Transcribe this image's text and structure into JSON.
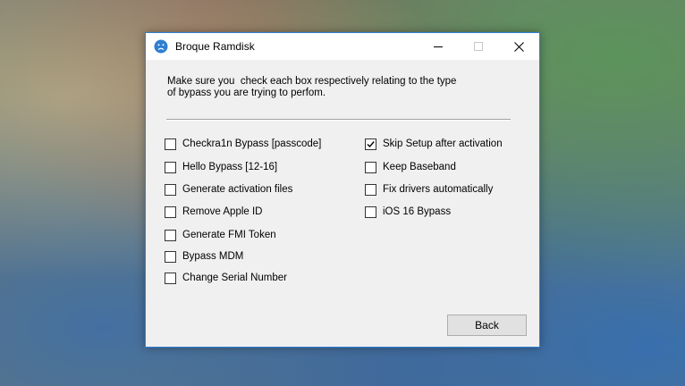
{
  "window": {
    "title": "Broque Ramdisk",
    "accent_color": "#2f7fd1",
    "icon": "sad-face-icon"
  },
  "intro": {
    "line1": "Make sure you  check each box respectively relating to the type",
    "line2": "of bypass you are trying to perfom."
  },
  "left_options": [
    {
      "label": "Checkra1n Bypass [passcode]",
      "checked": false
    },
    {
      "label": "Hello Bypass [12-16]",
      "checked": false
    },
    {
      "label": "Generate activation files",
      "checked": false
    },
    {
      "label": "Remove Apple ID",
      "checked": false
    },
    {
      "label": "Generate FMI Token",
      "checked": false
    },
    {
      "label": "Bypass MDM",
      "checked": false
    },
    {
      "label": "Change Serial Number",
      "checked": false
    }
  ],
  "right_options": [
    {
      "label": "Skip Setup after activation",
      "checked": true
    },
    {
      "label": "Keep Baseband",
      "checked": false
    },
    {
      "label": "Fix drivers automatically",
      "checked": false
    },
    {
      "label": "iOS 16 Bypass",
      "checked": false
    }
  ],
  "back_label": "Back"
}
